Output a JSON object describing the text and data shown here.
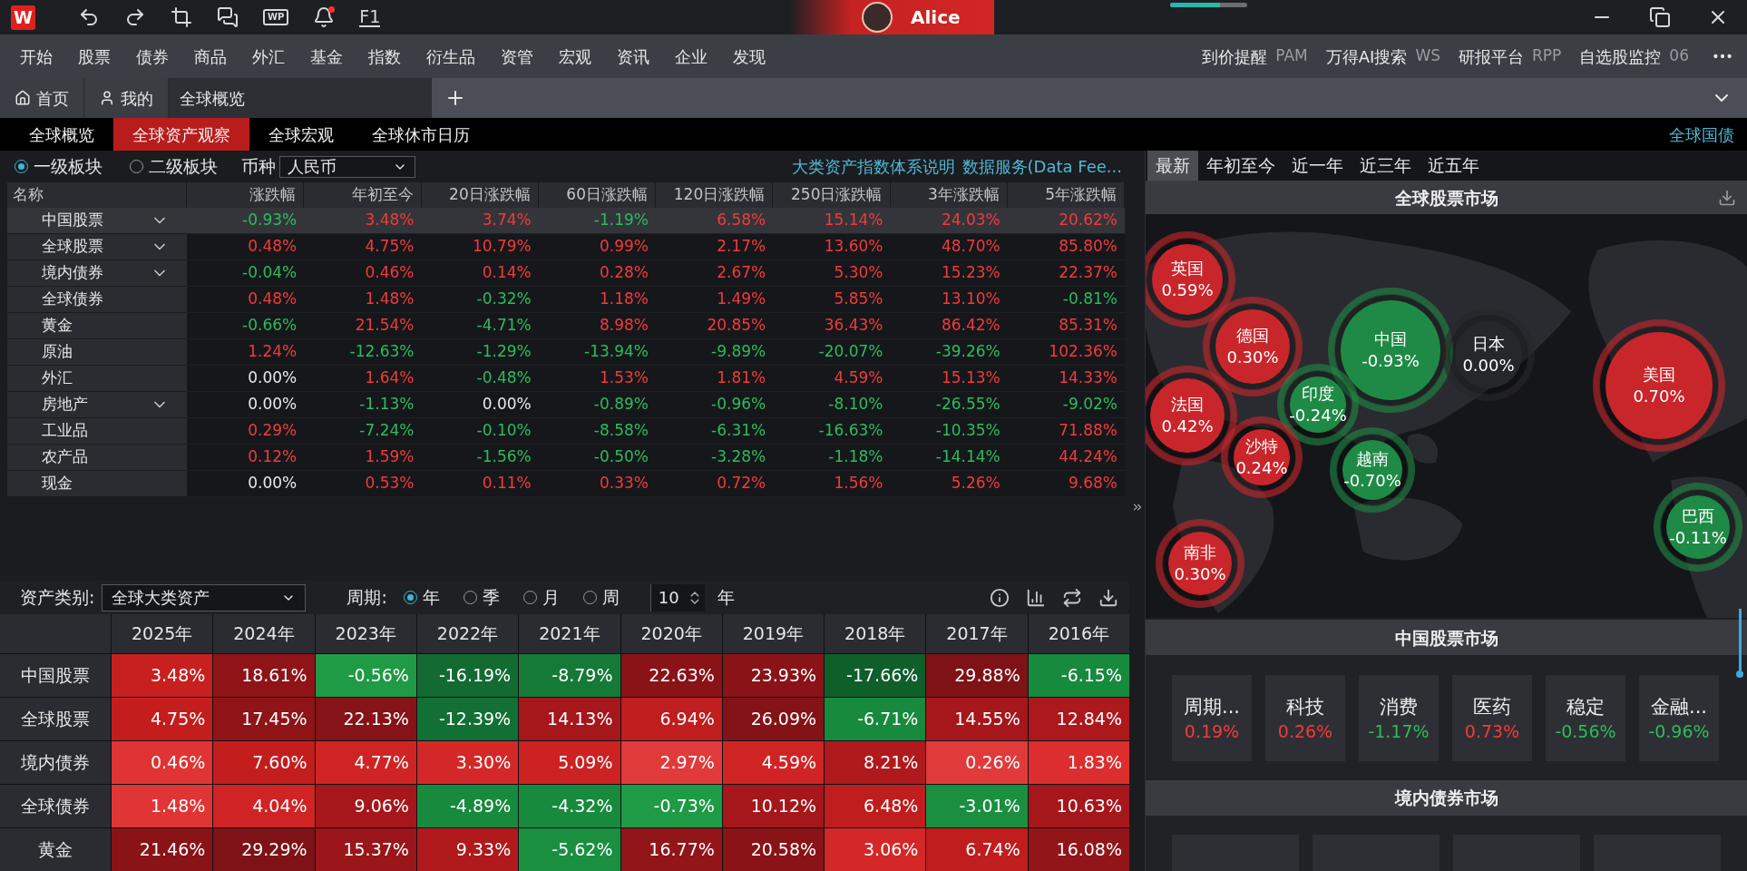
{
  "title_bar": {
    "logo": "W",
    "wp_label": "WP",
    "help_key": "F1",
    "notification_badge": true,
    "user": {
      "name": "Alice"
    },
    "progress": {
      "level": 0.65
    }
  },
  "menu": [
    "开始",
    "股票",
    "债券",
    "商品",
    "外汇",
    "基金",
    "指数",
    "衍生品",
    "资管",
    "宏观",
    "资讯",
    "企业",
    "发现"
  ],
  "menu_shortcuts": [
    {
      "label": "到价提醒",
      "code": "PAM"
    },
    {
      "label": "万得AI搜索",
      "code": "WS"
    },
    {
      "label": "研报平台",
      "code": "RPP"
    },
    {
      "label": "自选股监控",
      "code": "06"
    }
  ],
  "tabs": [
    {
      "label": "首页",
      "selected": false
    },
    {
      "label": "我的",
      "selected": false
    },
    {
      "label": "全球概览",
      "selected": true
    }
  ],
  "sub_tabs": [
    {
      "label": "全球概览",
      "selected": false
    },
    {
      "label": "全球资产观察",
      "selected": true
    },
    {
      "label": "全球宏观",
      "selected": false
    },
    {
      "label": "全球休市日历",
      "selected": false
    }
  ],
  "sub_tab_link": "全球国债",
  "asset_table": {
    "levels": [
      {
        "label": "一级板块",
        "selected": true
      },
      {
        "label": "二级板块",
        "selected": false
      }
    ],
    "currency_label": "币种",
    "currency": "人民币",
    "links": [
      "大类资产指数体系说明",
      "数据服务(Data Fee..."
    ],
    "name_column": "名称",
    "columns": [
      "涨跌幅",
      "年初至今",
      "20日涨跌幅",
      "60日涨跌幅",
      "120日涨跌幅",
      "250日涨跌幅",
      "3年涨跌幅",
      "5年涨跌幅"
    ],
    "rows": [
      {
        "name": "中国股票",
        "expandable": true,
        "selected": true,
        "cells": [
          {
            "value": "-0.93%",
            "color": "#2bbd5c"
          },
          {
            "value": "3.48%",
            "color": "#f23b3b"
          },
          {
            "value": "3.74%",
            "color": "#f23b3b"
          },
          {
            "value": "-1.19%",
            "color": "#2bbd5c"
          },
          {
            "value": "6.58%",
            "color": "#f23b3b"
          },
          {
            "value": "15.14%",
            "color": "#f23b3b"
          },
          {
            "value": "24.03%",
            "color": "#f23b3b"
          },
          {
            "value": "20.62%",
            "color": "#f23b3b"
          }
        ]
      },
      {
        "name": "全球股票",
        "expandable": true,
        "selected": false,
        "cells": [
          {
            "value": "0.48%",
            "color": "#f23b3b"
          },
          {
            "value": "4.75%",
            "color": "#f23b3b"
          },
          {
            "value": "10.79%",
            "color": "#f23b3b"
          },
          {
            "value": "0.99%",
            "color": "#f23b3b"
          },
          {
            "value": "2.17%",
            "color": "#f23b3b"
          },
          {
            "value": "13.60%",
            "color": "#f23b3b"
          },
          {
            "value": "48.70%",
            "color": "#f23b3b"
          },
          {
            "value": "85.80%",
            "color": "#f23b3b"
          }
        ]
      },
      {
        "name": "境内债券",
        "expandable": true,
        "selected": false,
        "cells": [
          {
            "value": "-0.04%",
            "color": "#2bbd5c"
          },
          {
            "value": "0.46%",
            "color": "#f23b3b"
          },
          {
            "value": "0.14%",
            "color": "#f23b3b"
          },
          {
            "value": "0.28%",
            "color": "#f23b3b"
          },
          {
            "value": "2.67%",
            "color": "#f23b3b"
          },
          {
            "value": "5.30%",
            "color": "#f23b3b"
          },
          {
            "value": "15.23%",
            "color": "#f23b3b"
          },
          {
            "value": "22.37%",
            "color": "#f23b3b"
          }
        ]
      },
      {
        "name": "全球债券",
        "expandable": false,
        "selected": false,
        "cells": [
          {
            "value": "0.48%",
            "color": "#f23b3b"
          },
          {
            "value": "1.48%",
            "color": "#f23b3b"
          },
          {
            "value": "-0.32%",
            "color": "#2bbd5c"
          },
          {
            "value": "1.18%",
            "color": "#f23b3b"
          },
          {
            "value": "1.49%",
            "color": "#f23b3b"
          },
          {
            "value": "5.85%",
            "color": "#f23b3b"
          },
          {
            "value": "13.10%",
            "color": "#f23b3b"
          },
          {
            "value": "-0.81%",
            "color": "#2bbd5c"
          }
        ]
      },
      {
        "name": "黄金",
        "expandable": false,
        "selected": false,
        "cells": [
          {
            "value": "-0.66%",
            "color": "#2bbd5c"
          },
          {
            "value": "21.54%",
            "color": "#f23b3b"
          },
          {
            "value": "-4.71%",
            "color": "#2bbd5c"
          },
          {
            "value": "8.98%",
            "color": "#f23b3b"
          },
          {
            "value": "20.85%",
            "color": "#f23b3b"
          },
          {
            "value": "36.43%",
            "color": "#f23b3b"
          },
          {
            "value": "86.42%",
            "color": "#f23b3b"
          },
          {
            "value": "85.31%",
            "color": "#f23b3b"
          }
        ]
      },
      {
        "name": "原油",
        "expandable": false,
        "selected": false,
        "cells": [
          {
            "value": "1.24%",
            "color": "#f23b3b"
          },
          {
            "value": "-12.63%",
            "color": "#2bbd5c"
          },
          {
            "value": "-1.29%",
            "color": "#2bbd5c"
          },
          {
            "value": "-13.94%",
            "color": "#2bbd5c"
          },
          {
            "value": "-9.89%",
            "color": "#2bbd5c"
          },
          {
            "value": "-20.07%",
            "color": "#2bbd5c"
          },
          {
            "value": "-39.26%",
            "color": "#2bbd5c"
          },
          {
            "value": "102.36%",
            "color": "#f23b3b"
          }
        ]
      },
      {
        "name": "外汇",
        "expandable": false,
        "selected": false,
        "cells": [
          {
            "value": "0.00%",
            "color": "#e8e8e8"
          },
          {
            "value": "1.64%",
            "color": "#f23b3b"
          },
          {
            "value": "-0.48%",
            "color": "#2bbd5c"
          },
          {
            "value": "1.53%",
            "color": "#f23b3b"
          },
          {
            "value": "1.81%",
            "color": "#f23b3b"
          },
          {
            "value": "4.59%",
            "color": "#f23b3b"
          },
          {
            "value": "15.13%",
            "color": "#f23b3b"
          },
          {
            "value": "14.33%",
            "color": "#f23b3b"
          }
        ]
      },
      {
        "name": "房地产",
        "expandable": true,
        "selected": false,
        "cells": [
          {
            "value": "0.00%",
            "color": "#e8e8e8"
          },
          {
            "value": "-1.13%",
            "color": "#2bbd5c"
          },
          {
            "value": "0.00%",
            "color": "#e8e8e8"
          },
          {
            "value": "-0.89%",
            "color": "#2bbd5c"
          },
          {
            "value": "-0.96%",
            "color": "#2bbd5c"
          },
          {
            "value": "-8.10%",
            "color": "#2bbd5c"
          },
          {
            "value": "-26.55%",
            "color": "#2bbd5c"
          },
          {
            "value": "-9.02%",
            "color": "#2bbd5c"
          }
        ]
      },
      {
        "name": "工业品",
        "expandable": false,
        "selected": false,
        "cells": [
          {
            "value": "0.29%",
            "color": "#f23b3b"
          },
          {
            "value": "-7.24%",
            "color": "#2bbd5c"
          },
          {
            "value": "-0.10%",
            "color": "#2bbd5c"
          },
          {
            "value": "-8.58%",
            "color": "#2bbd5c"
          },
          {
            "value": "-6.31%",
            "color": "#2bbd5c"
          },
          {
            "value": "-16.63%",
            "color": "#2bbd5c"
          },
          {
            "value": "-10.35%",
            "color": "#2bbd5c"
          },
          {
            "value": "71.88%",
            "color": "#f23b3b"
          }
        ]
      },
      {
        "name": "农产品",
        "expandable": false,
        "selected": false,
        "cells": [
          {
            "value": "0.12%",
            "color": "#f23b3b"
          },
          {
            "value": "1.59%",
            "color": "#f23b3b"
          },
          {
            "value": "-1.56%",
            "color": "#2bbd5c"
          },
          {
            "value": "-0.50%",
            "color": "#2bbd5c"
          },
          {
            "value": "-3.28%",
            "color": "#2bbd5c"
          },
          {
            "value": "-1.18%",
            "color": "#2bbd5c"
          },
          {
            "value": "-14.14%",
            "color": "#2bbd5c"
          },
          {
            "value": "44.24%",
            "color": "#f23b3b"
          }
        ]
      },
      {
        "name": "现金",
        "expandable": false,
        "selected": false,
        "cells": [
          {
            "value": "0.00%",
            "color": "#e8e8e8"
          },
          {
            "value": "0.53%",
            "color": "#f23b3b"
          },
          {
            "value": "0.11%",
            "color": "#f23b3b"
          },
          {
            "value": "0.33%",
            "color": "#f23b3b"
          },
          {
            "value": "0.72%",
            "color": "#f23b3b"
          },
          {
            "value": "1.56%",
            "color": "#f23b3b"
          },
          {
            "value": "5.26%",
            "color": "#f23b3b"
          },
          {
            "value": "9.68%",
            "color": "#f23b3b"
          }
        ]
      }
    ]
  },
  "annual_returns": {
    "category_label": "资产类别:",
    "category": "全球大类资产",
    "period_label": "周期:",
    "periods": [
      {
        "label": "年",
        "selected": true
      },
      {
        "label": "季",
        "selected": false
      },
      {
        "label": "月",
        "selected": false
      },
      {
        "label": "周",
        "selected": false
      }
    ],
    "count": "10",
    "count_unit": "年",
    "columns": [
      "2025年",
      "2024年",
      "2023年",
      "2022年",
      "2021年",
      "2020年",
      "2019年",
      "2018年",
      "2017年",
      "2016年"
    ],
    "rows": [
      {
        "name": "中国股票",
        "cells": [
          {
            "value": "3.48%",
            "color": "#c8201f"
          },
          {
            "value": "18.61%",
            "color": "#8e1418"
          },
          {
            "value": "-0.56%",
            "color": "#1f9a45"
          },
          {
            "value": "-16.19%",
            "color": "#136b32"
          },
          {
            "value": "-8.79%",
            "color": "#157a37"
          },
          {
            "value": "22.63%",
            "color": "#8a1317"
          },
          {
            "value": "23.93%",
            "color": "#8a1317"
          },
          {
            "value": "-17.66%",
            "color": "#0f5f2b"
          },
          {
            "value": "29.88%",
            "color": "#7f1216"
          },
          {
            "value": "-6.15%",
            "color": "#178a3d"
          }
        ]
      },
      {
        "name": "全球股票",
        "cells": [
          {
            "value": "4.75%",
            "color": "#c41d1e"
          },
          {
            "value": "17.45%",
            "color": "#8f1418"
          },
          {
            "value": "22.13%",
            "color": "#861317"
          },
          {
            "value": "-12.39%",
            "color": "#137034"
          },
          {
            "value": "14.13%",
            "color": "#a5171b"
          },
          {
            "value": "6.94%",
            "color": "#c01d1e"
          },
          {
            "value": "26.09%",
            "color": "#841317"
          },
          {
            "value": "-6.71%",
            "color": "#178a3d"
          },
          {
            "value": "14.55%",
            "color": "#a5171b"
          },
          {
            "value": "12.84%",
            "color": "#ad181c"
          }
        ]
      },
      {
        "name": "境内债券",
        "cells": [
          {
            "value": "0.46%",
            "color": "#e03333"
          },
          {
            "value": "7.60%",
            "color": "#c41d1e"
          },
          {
            "value": "4.77%",
            "color": "#d02424"
          },
          {
            "value": "3.30%",
            "color": "#d42828"
          },
          {
            "value": "5.09%",
            "color": "#cc2222"
          },
          {
            "value": "2.97%",
            "color": "#e03a3a"
          },
          {
            "value": "4.59%",
            "color": "#d02424"
          },
          {
            "value": "8.21%",
            "color": "#b01a1d"
          },
          {
            "value": "0.26%",
            "color": "#e03a3a"
          },
          {
            "value": "1.83%",
            "color": "#dc2e2e"
          }
        ]
      },
      {
        "name": "全球债券",
        "cells": [
          {
            "value": "1.48%",
            "color": "#e03535"
          },
          {
            "value": "4.04%",
            "color": "#d02424"
          },
          {
            "value": "9.06%",
            "color": "#a5171b"
          },
          {
            "value": "-4.89%",
            "color": "#178a3d"
          },
          {
            "value": "-4.32%",
            "color": "#178a3d"
          },
          {
            "value": "-0.73%",
            "color": "#1f9a45"
          },
          {
            "value": "10.12%",
            "color": "#a5171b"
          },
          {
            "value": "6.48%",
            "color": "#c01d1e"
          },
          {
            "value": "-3.01%",
            "color": "#1a8f40"
          },
          {
            "value": "10.63%",
            "color": "#a5171b"
          }
        ]
      },
      {
        "name": "黄金",
        "cells": [
          {
            "value": "21.46%",
            "color": "#8a1317"
          },
          {
            "value": "29.29%",
            "color": "#7f1216"
          },
          {
            "value": "15.37%",
            "color": "#9a161a"
          },
          {
            "value": "9.33%",
            "color": "#b01a1d"
          },
          {
            "value": "-5.62%",
            "color": "#1a8f40"
          },
          {
            "value": "16.77%",
            "color": "#921519"
          },
          {
            "value": "20.58%",
            "color": "#8a1317"
          },
          {
            "value": "3.06%",
            "color": "#d42828"
          },
          {
            "value": "6.74%",
            "color": "#c01d1e"
          },
          {
            "value": "16.08%",
            "color": "#921519"
          }
        ]
      }
    ]
  },
  "market_tabs": [
    {
      "label": "最新",
      "selected": true
    },
    {
      "label": "年初至今",
      "selected": false
    },
    {
      "label": "近一年",
      "selected": false
    },
    {
      "label": "近三年",
      "selected": false
    },
    {
      "label": "近五年",
      "selected": false
    }
  ],
  "global_market": {
    "title": "全球股票市场",
    "bubbles": [
      {
        "name": "英国",
        "value": "0.59%",
        "color": "#c9262b"
      },
      {
        "name": "德国",
        "value": "0.30%",
        "color": "#c9262b"
      },
      {
        "name": "中国",
        "value": "-0.93%",
        "color": "#1f8a45"
      },
      {
        "name": "日本",
        "value": "0.00%",
        "color": "#26272b"
      },
      {
        "name": "美国",
        "value": "0.70%",
        "color": "#c9262b"
      },
      {
        "name": "法国",
        "value": "0.42%",
        "color": "#c9262b"
      },
      {
        "name": "印度",
        "value": "-0.24%",
        "color": "#1f8a45"
      },
      {
        "name": "沙特",
        "value": "0.24%",
        "color": "#c9262b"
      },
      {
        "name": "越南",
        "value": "-0.70%",
        "color": "#1f8a45"
      },
      {
        "name": "巴西",
        "value": "-0.11%",
        "color": "#1f8a45"
      },
      {
        "name": "南非",
        "value": "0.30%",
        "color": "#c9262b"
      }
    ]
  },
  "china_market": {
    "title": "中国股票市场",
    "sectors": [
      {
        "name": "周期...",
        "value": "0.19%",
        "color": "#f23b3b"
      },
      {
        "name": "科技",
        "value": "0.26%",
        "color": "#f23b3b"
      },
      {
        "name": "消费",
        "value": "-1.17%",
        "color": "#2bbd5c"
      },
      {
        "name": "医药",
        "value": "0.73%",
        "color": "#f23b3b"
      },
      {
        "name": "稳定",
        "value": "-0.56%",
        "color": "#2bbd5c"
      },
      {
        "name": "金融...",
        "value": "-0.96%",
        "color": "#2bbd5c"
      }
    ]
  },
  "bond_market": {
    "title": "境内债券市场"
  }
}
